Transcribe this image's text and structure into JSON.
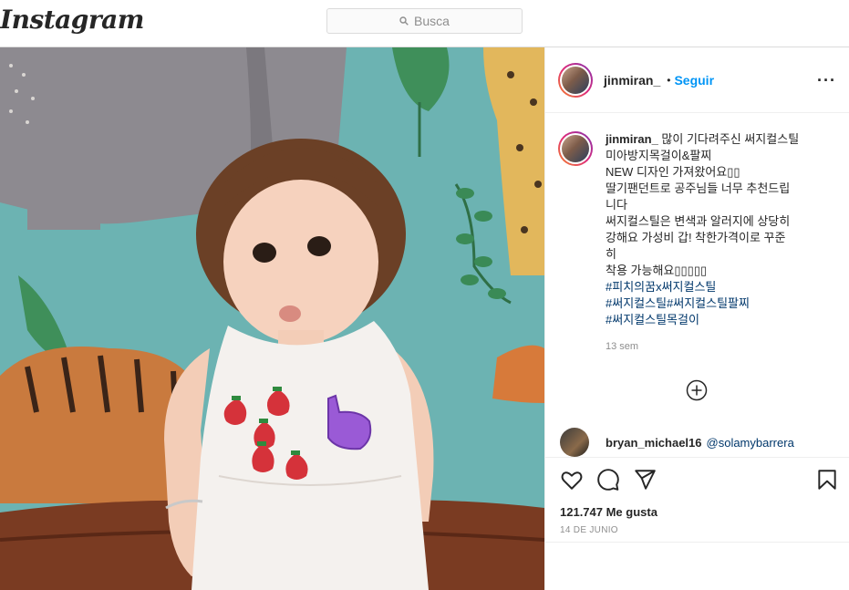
{
  "app": {
    "logo": "Instagram"
  },
  "search": {
    "placeholder": "Busca"
  },
  "post": {
    "author": "jinmiran_",
    "separator": "•",
    "follow_label": "Seguir",
    "more_label": "···",
    "caption": {
      "username": "jinmiran_",
      "text": " 많이 기다려주신 써지컬스틸\n미아방지목걸이&팔찌\nNEW 디자인 가져왔어요▯▯\n딸기팬던트로 공주님들 너무 추천드립\n니다\n써지컬스틸은 변색과 알러지에 상당히\n강해요 가성비 갑! 착한가격이로 꾸준\n히\n착용 가능해요▯▯▯▯▯",
      "hashtags": "#피치의꿈x써지컬스틸\n#써지컬스틸#써지컬스틸팔찌\n#써지컬스틸목걸이",
      "time": "13 sem"
    },
    "comment": {
      "username": "bryan_michael16",
      "mention": "@solamybarrera"
    },
    "likes": "121.747 Me gusta",
    "date": "14 DE JUNIO"
  },
  "icons": [
    "search-icon",
    "more-icon",
    "add-comments-icon",
    "heart-icon",
    "comment-icon",
    "share-icon",
    "bookmark-icon"
  ],
  "colors": {
    "link": "#0095f6",
    "hashtag": "#00376b",
    "muted": "#8e8e8e",
    "border": "#dbdbdb"
  }
}
